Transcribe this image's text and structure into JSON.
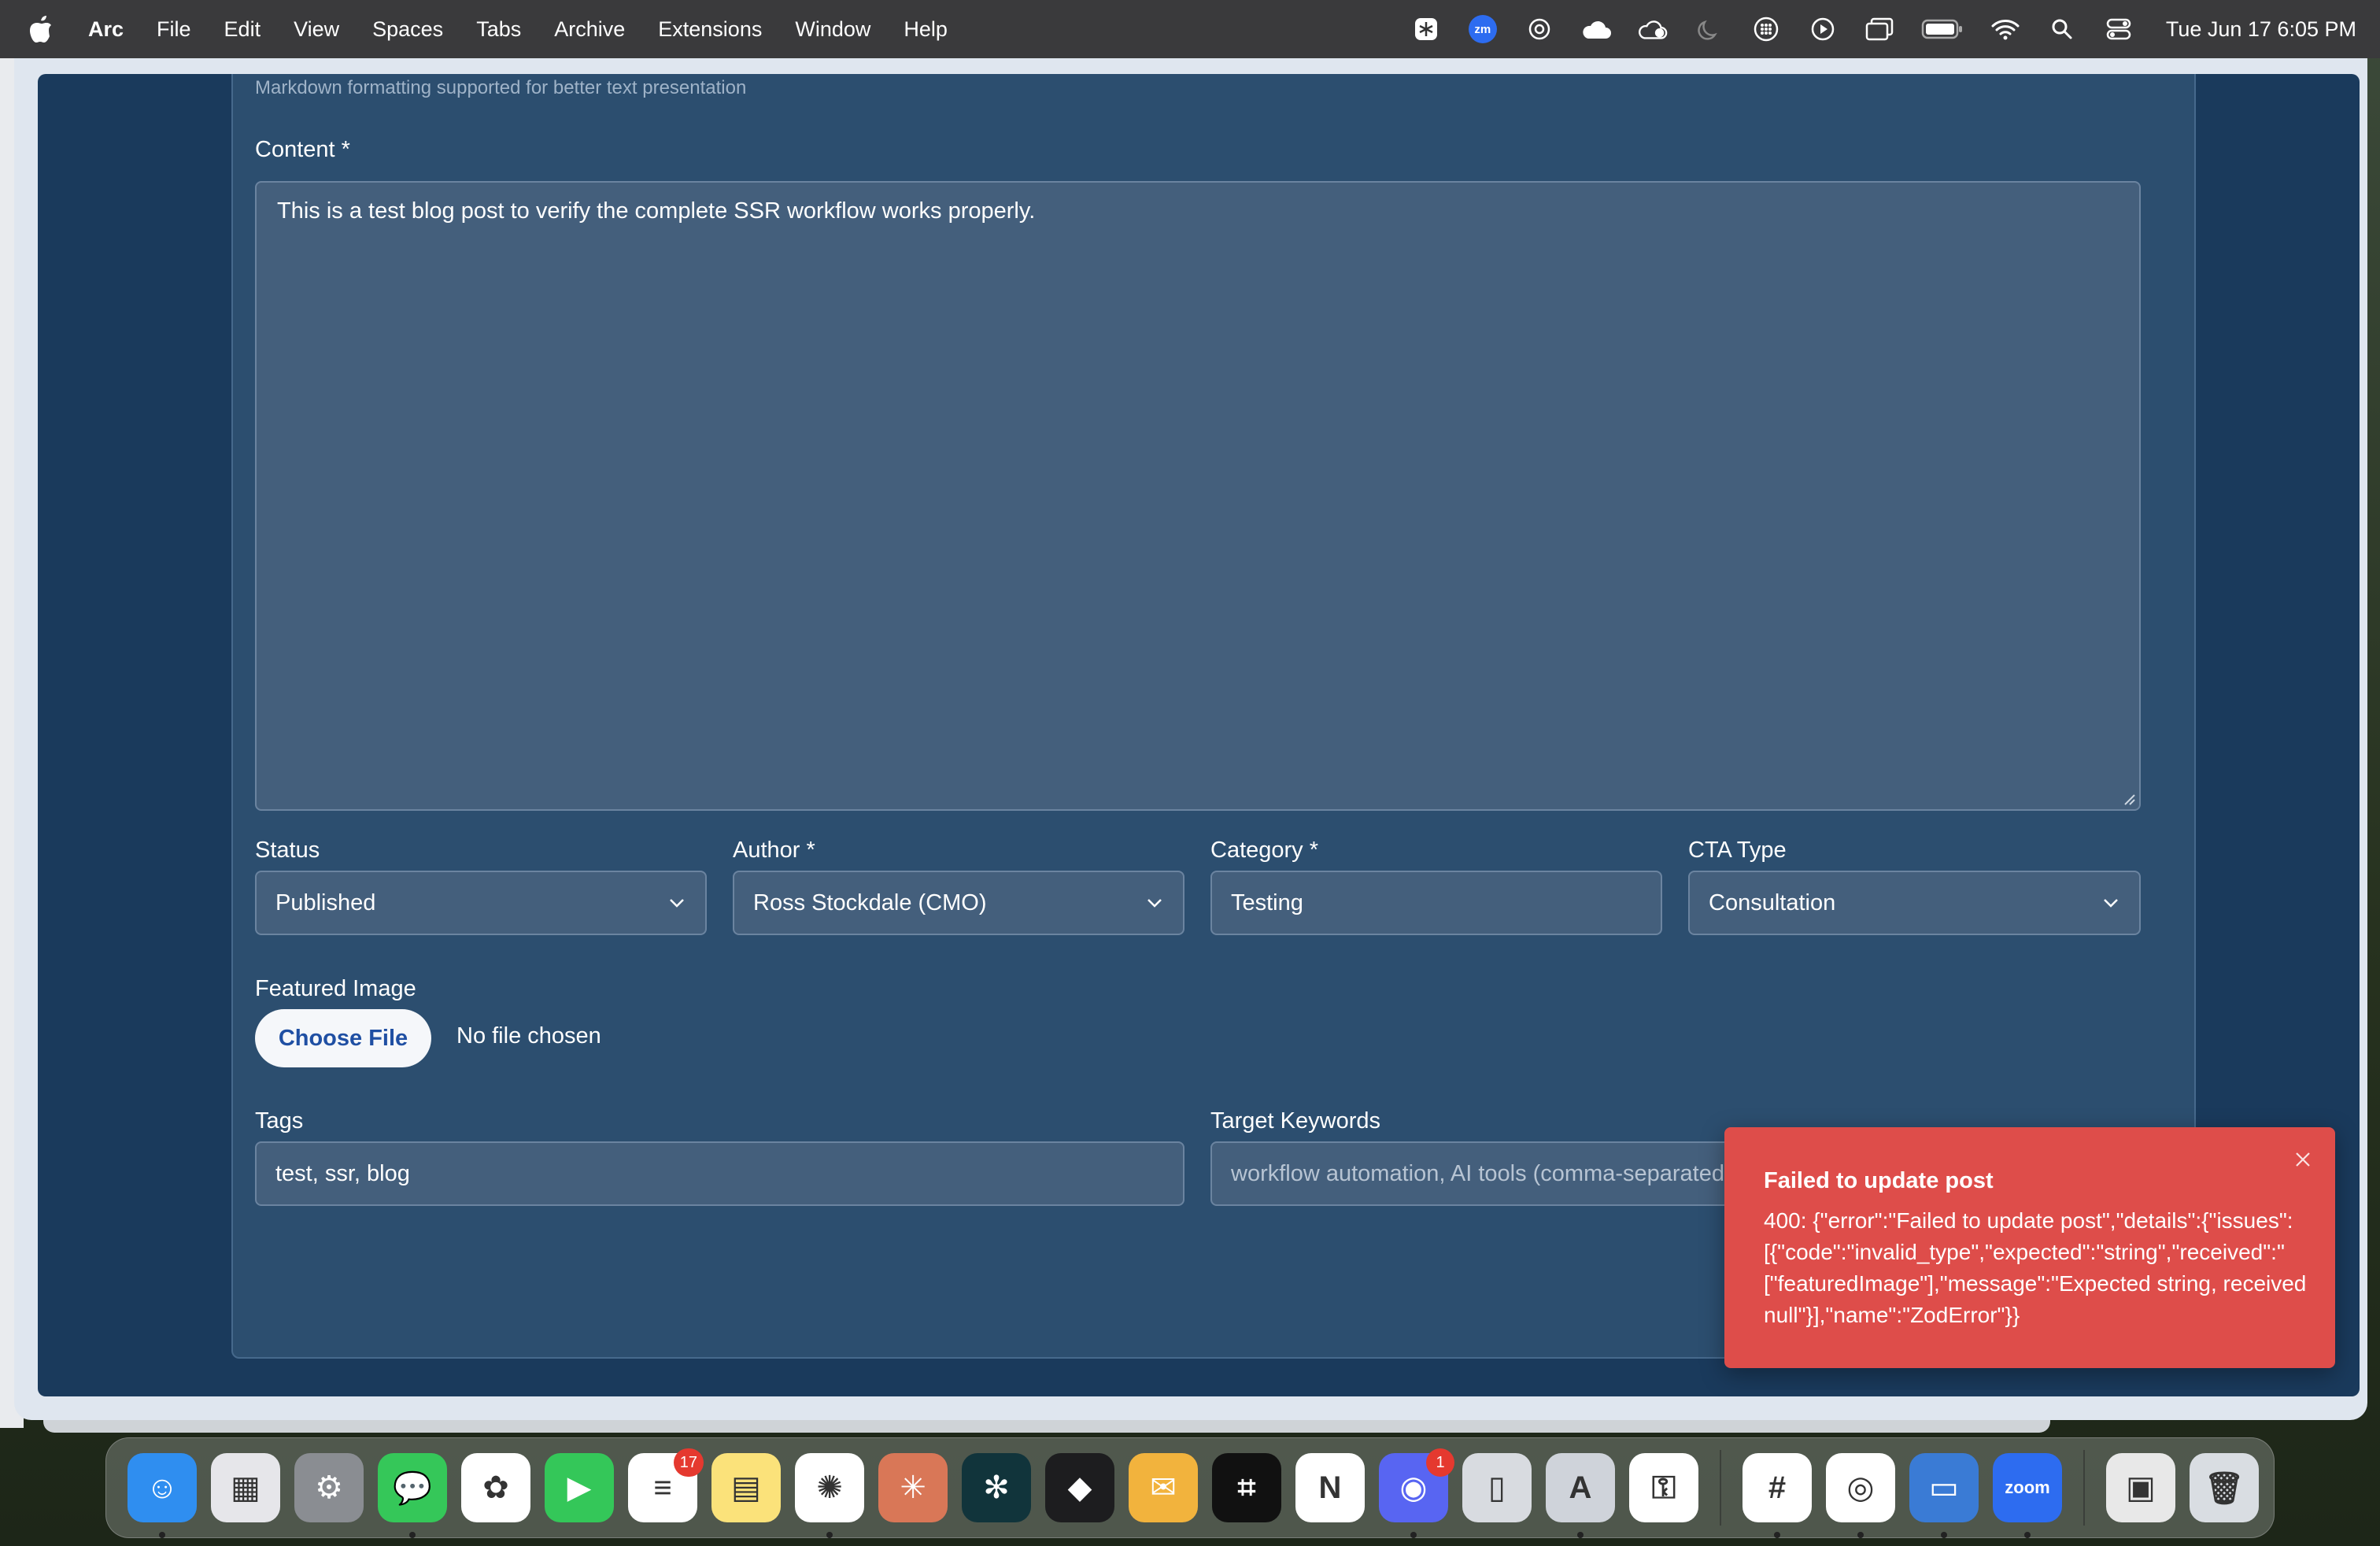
{
  "menubar": {
    "app_name": "Arc",
    "items": [
      "File",
      "Edit",
      "View",
      "Spaces",
      "Tabs",
      "Archive",
      "Extensions",
      "Window",
      "Help"
    ],
    "tray_icons": [
      "perplexity-icon",
      "zoom-icon",
      "chatgpt-icon",
      "cloud-icon",
      "cloud-sync-icon",
      "moon-icon",
      "grid-icon",
      "play-icon",
      "window-icon",
      "battery-icon",
      "wifi-icon",
      "search-icon",
      "control-center-icon"
    ],
    "zoom_badge": "zm",
    "clock": "Tue Jun 17  6:05 PM"
  },
  "form": {
    "markdown_hint": "Markdown formatting supported for better text presentation",
    "content_label": "Content *",
    "content_value": "This is a test blog post to verify the complete SSR workflow works properly.",
    "status_label": "Status",
    "status_value": "Published",
    "author_label": "Author *",
    "author_value": "Ross Stockdale (CMO)",
    "category_label": "Category *",
    "category_value": "Testing",
    "cta_label": "CTA Type",
    "cta_value": "Consultation",
    "featured_label": "Featured Image",
    "choose_file_label": "Choose File",
    "file_status": "No file chosen",
    "tags_label": "Tags",
    "tags_value": "test, ssr, blog",
    "keywords_label": "Target Keywords",
    "keywords_placeholder": "workflow automation, AI tools (comma-separated)"
  },
  "toast": {
    "title": "Failed to update post",
    "body": "400: {\"error\":\"Failed to update post\",\"details\":{\"issues\":\n[{\"code\":\"invalid_type\",\"expected\":\"string\",\"received\":\"\n[\"featuredImage\"],\"message\":\"Expected string, received\nnull\"}],\"name\":\"ZodError\"}}"
  },
  "dock": {
    "apps": [
      {
        "name": "finder",
        "glyph": "☺",
        "color": "#2f8ef0",
        "running": true
      },
      {
        "name": "launchpad",
        "glyph": "▦",
        "color": "#e6e6ea",
        "running": false
      },
      {
        "name": "system-settings",
        "glyph": "⚙",
        "color": "#8a8d92",
        "running": false
      },
      {
        "name": "messages",
        "glyph": "💬",
        "color": "#35c759",
        "running": true
      },
      {
        "name": "photos",
        "glyph": "✿",
        "color": "#ffffff",
        "running": false
      },
      {
        "name": "facetime",
        "glyph": "▶",
        "color": "#34c759",
        "running": false
      },
      {
        "name": "reminders",
        "glyph": "≡",
        "color": "#ffffff",
        "running": false,
        "badge": "17"
      },
      {
        "name": "notes",
        "glyph": "▤",
        "color": "#fbe27a",
        "running": false
      },
      {
        "name": "chatgpt",
        "glyph": "✺",
        "color": "#ffffff",
        "running": true
      },
      {
        "name": "claude",
        "glyph": "✳",
        "color": "#d97757",
        "running": false
      },
      {
        "name": "perplexity",
        "glyph": "✻",
        "color": "#11343b",
        "running": false
      },
      {
        "name": "raycast",
        "glyph": "◆",
        "color": "#1d1d1f",
        "running": false
      },
      {
        "name": "airmail",
        "glyph": "✉",
        "color": "#f2b33d",
        "running": false
      },
      {
        "name": "screenshot",
        "glyph": "⌗",
        "color": "#111111",
        "running": false
      },
      {
        "name": "notion",
        "glyph": "N",
        "color": "#ffffff",
        "running": false
      },
      {
        "name": "discord",
        "glyph": "◉",
        "color": "#5865f2",
        "running": true,
        "badge": "1"
      },
      {
        "name": "iphone-mirroring",
        "glyph": "▯",
        "color": "#d8dbe0",
        "running": false
      },
      {
        "name": "craft",
        "glyph": "A",
        "color": "#cfd3da",
        "running": true
      },
      {
        "name": "passwords",
        "glyph": "⚿",
        "color": "#ffffff",
        "running": false
      },
      {
        "name": "slack",
        "glyph": "#",
        "color": "#ffffff",
        "running": true
      },
      {
        "name": "chrome",
        "glyph": "◎",
        "color": "#ffffff",
        "running": true
      },
      {
        "name": "screen-sharing",
        "glyph": "▭",
        "color": "#3a7bd5",
        "running": true
      },
      {
        "name": "zoom",
        "glyph": "zoom",
        "color": "#2d6cf0",
        "running": true
      },
      {
        "name": "downloads-stack",
        "glyph": "▣",
        "color": "#e8e8e8",
        "running": false
      },
      {
        "name": "trash",
        "glyph": "🗑",
        "color": "#d9dde2",
        "running": false
      }
    ]
  }
}
